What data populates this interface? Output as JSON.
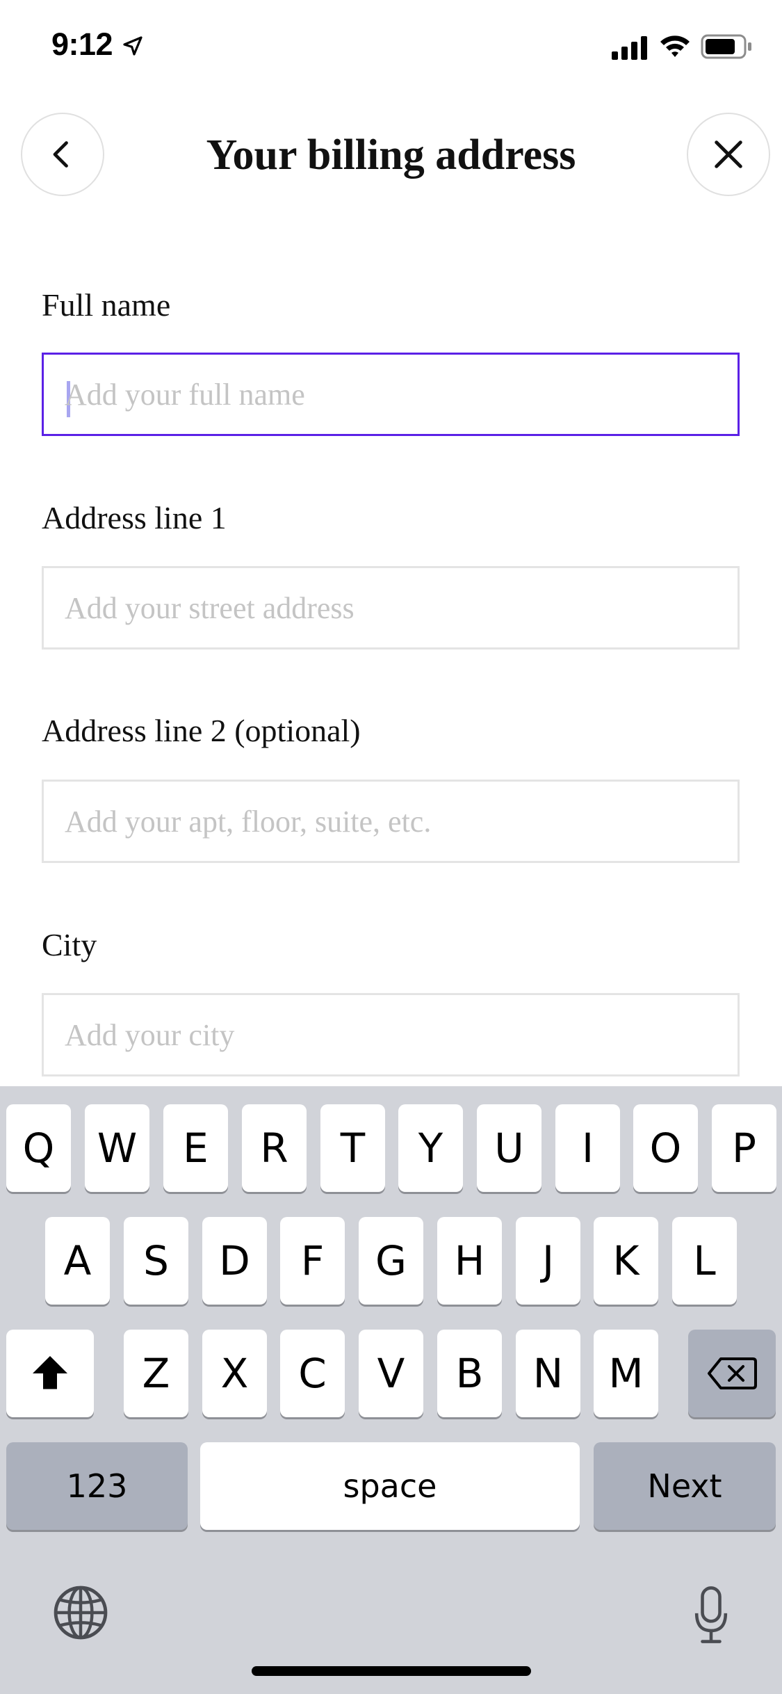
{
  "status_bar": {
    "time": "9:12",
    "icons": [
      "location-arrow-icon",
      "cellular-signal-icon",
      "wifi-icon",
      "battery-icon"
    ]
  },
  "header": {
    "title": "Your billing address",
    "back_icon": "chevron-left-icon",
    "close_icon": "close-icon"
  },
  "form": {
    "fields": [
      {
        "label": "Full name",
        "value": "",
        "placeholder": "Add your full name",
        "focused": true
      },
      {
        "label": "Address line 1",
        "value": "",
        "placeholder": "Add your street address",
        "focused": false
      },
      {
        "label": "Address line 2 (optional)",
        "value": "",
        "placeholder": "Add your apt, floor, suite, etc.",
        "focused": false
      },
      {
        "label": "City",
        "value": "",
        "placeholder": "Add your city",
        "focused": false
      }
    ]
  },
  "keyboard": {
    "row1": [
      "Q",
      "W",
      "E",
      "R",
      "T",
      "Y",
      "U",
      "I",
      "O",
      "P"
    ],
    "row2": [
      "A",
      "S",
      "D",
      "F",
      "G",
      "H",
      "J",
      "K",
      "L"
    ],
    "row3": [
      "Z",
      "X",
      "C",
      "V",
      "B",
      "N",
      "M"
    ],
    "numbers_label": "123",
    "space_label": "space",
    "next_label": "Next",
    "shift_icon": "shift-icon",
    "delete_icon": "backspace-icon",
    "globe_icon": "globe-icon",
    "mic_icon": "microphone-icon"
  },
  "colors": {
    "focus_border": "#5b21e6",
    "field_border": "#e4e4e4",
    "placeholder": "#c4c4c4",
    "keyboard_bg": "#d1d3d9",
    "key_dark": "#abb0bc"
  }
}
